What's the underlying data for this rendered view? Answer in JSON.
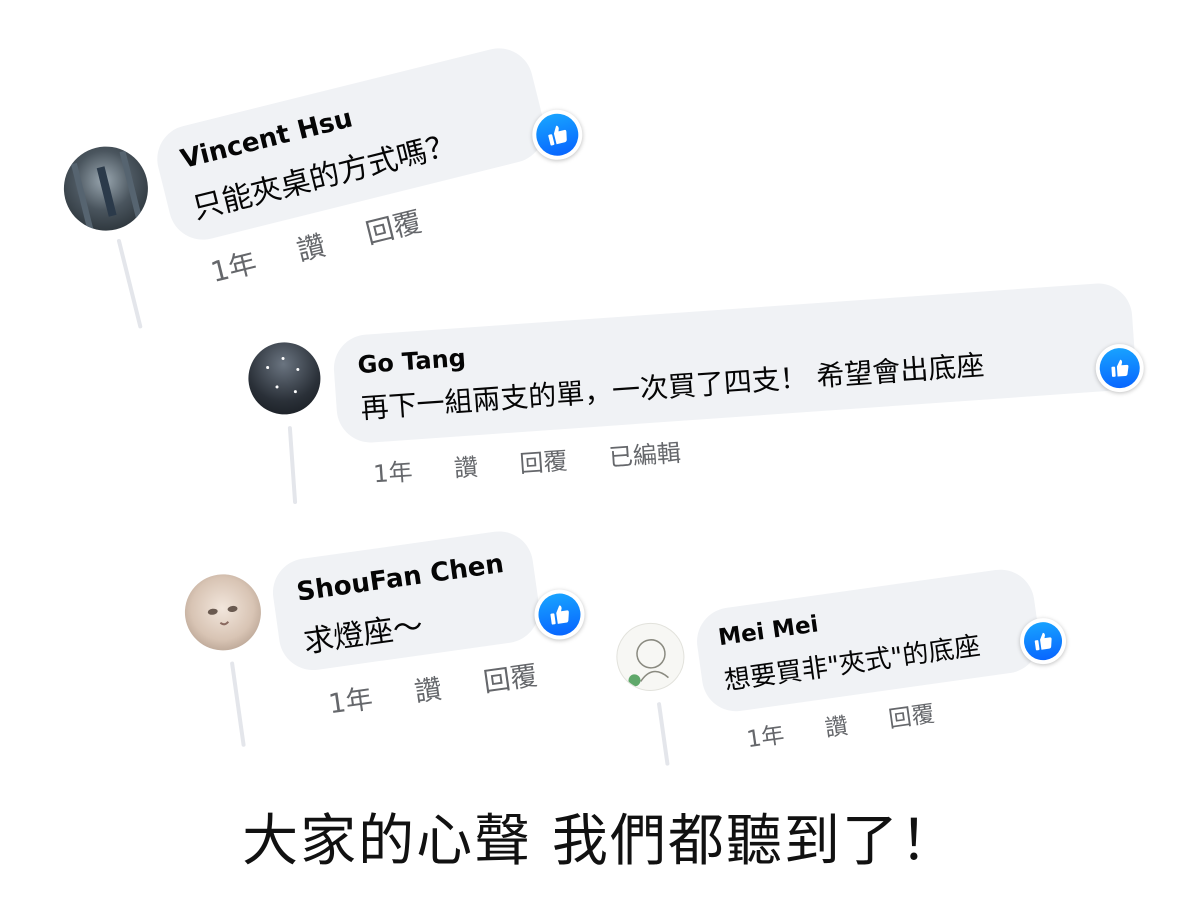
{
  "comments": [
    {
      "name": "Vincent Hsu",
      "text": "只能夾桌的方式嗎？",
      "time": "1年",
      "like": "讚",
      "reply": "回覆",
      "avatar_icon": "avatar-photo-icon"
    },
    {
      "name": "Go Tang",
      "text": "再下一組兩支的單，一次買了四支！ 希望會出底座",
      "time": "1年",
      "like": "讚",
      "reply": "回覆",
      "edited": "已編輯",
      "avatar_icon": "avatar-photo-icon"
    },
    {
      "name": "ShouFan Chen",
      "text": "求燈座～",
      "time": "1年",
      "like": "讚",
      "reply": "回覆",
      "avatar_icon": "cat-avatar-icon"
    },
    {
      "name": "Mei Mei",
      "text": "想要買非\"夾式\"的底座",
      "time": "1年",
      "like": "讚",
      "reply": "回覆",
      "avatar_icon": "drawing-avatar-icon"
    }
  ],
  "caption": "大家的心聲 我們都聽到了！",
  "colors": {
    "bubble": "#f0f2f5",
    "like_blue": "#0866ff",
    "meta_text": "#65676b"
  },
  "icons": {
    "like_badge": "thumbs-up-icon"
  }
}
